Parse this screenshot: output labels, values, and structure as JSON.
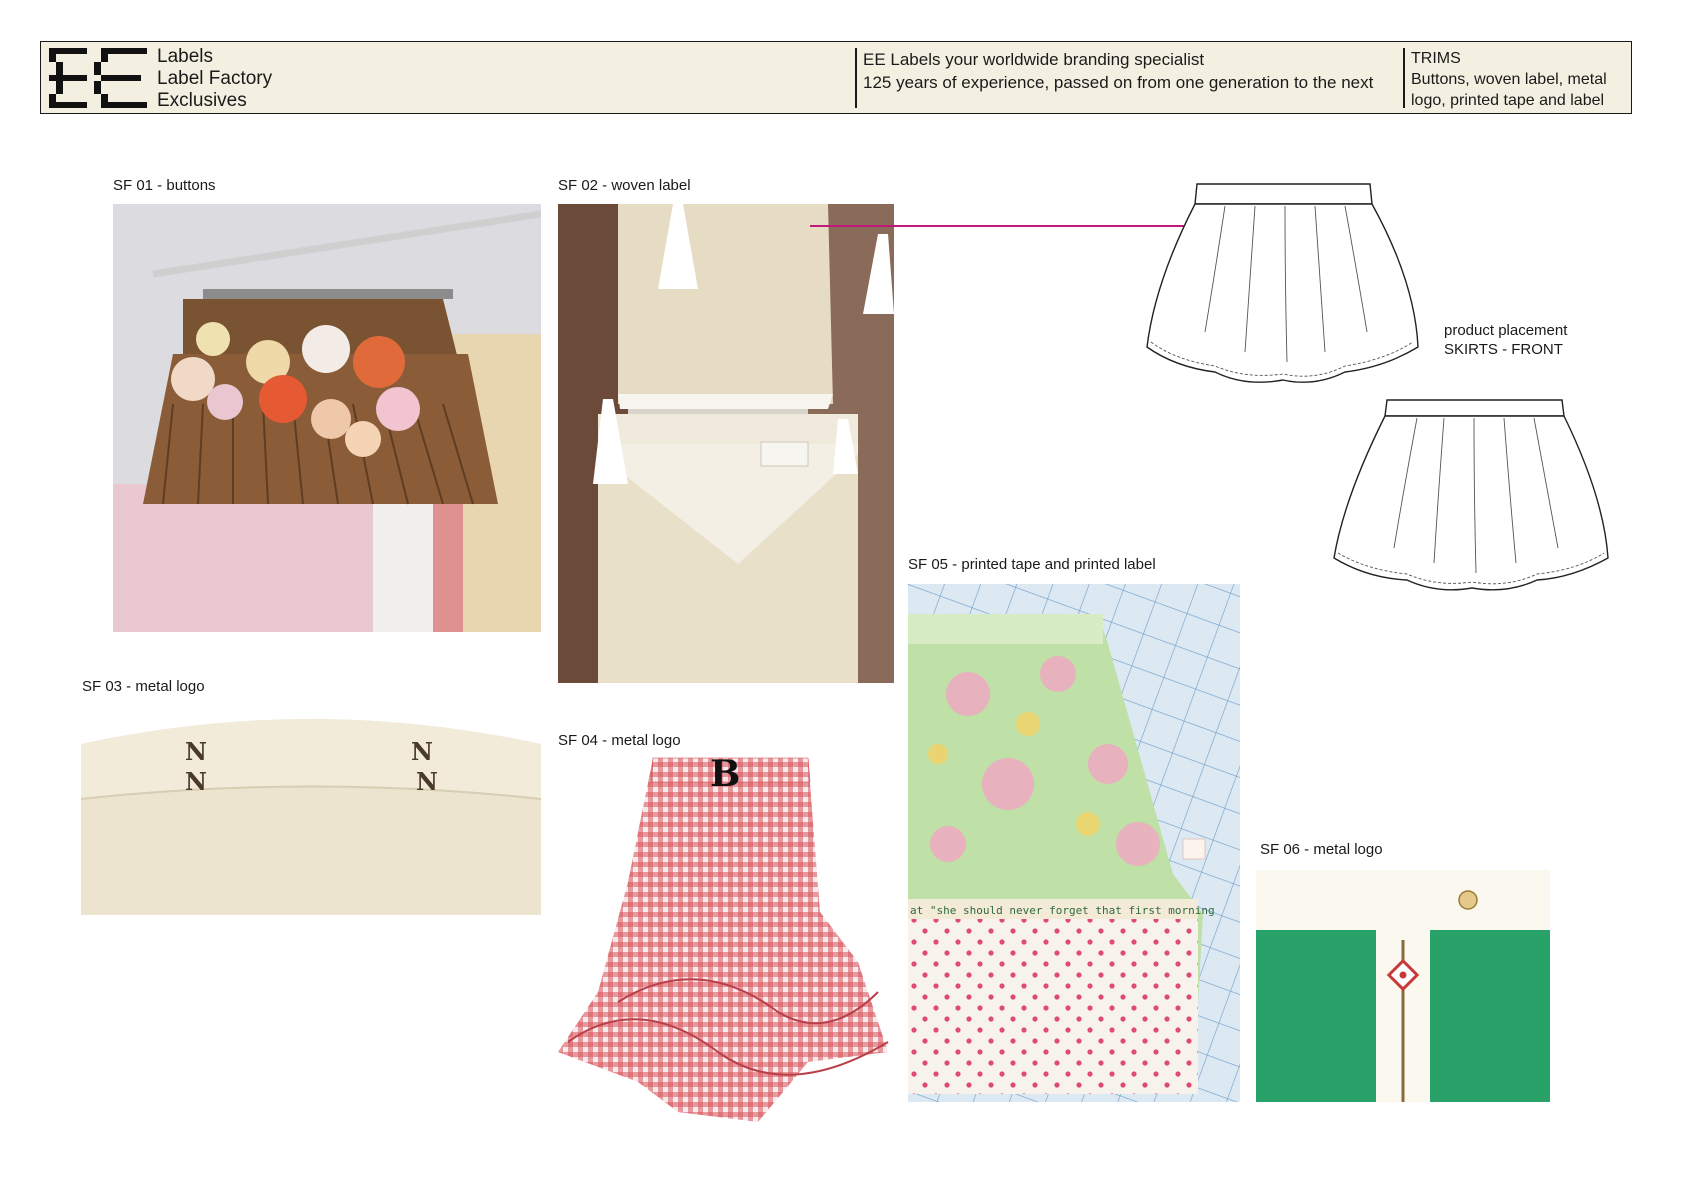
{
  "header": {
    "brand_lines": [
      "Labels",
      "Label Factory",
      "Exclusives"
    ],
    "tagline_1": "EE Labels your worldwide branding specialist",
    "tagline_2": "125 years of experience, passed on from one generation to the next",
    "trims_title": "TRIMS",
    "trims_line_1": "Buttons, woven label, metal",
    "trims_line_2": "logo, printed tape and label"
  },
  "items": [
    {
      "caption": "SF 01 - buttons"
    },
    {
      "caption": "SF 02 - woven label"
    },
    {
      "caption": "SF 03 - metal logo"
    },
    {
      "caption": "SF 04 - metal logo"
    },
    {
      "caption": "SF 05 - printed tape and printed label"
    },
    {
      "caption": "SF 06 - metal logo"
    }
  ],
  "placement": {
    "line_1": "product placement",
    "line_2": "SKIRTS - FRONT"
  },
  "colors": {
    "header_bg": "#f3f0e2",
    "placement_marker": "#c2187a"
  },
  "photo_texts": {
    "tape_text": "at \"she should never forget that first morning"
  }
}
